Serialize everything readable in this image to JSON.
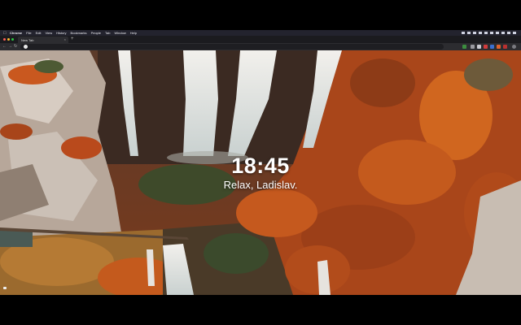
{
  "menubar": {
    "apple_icon": "apple-icon",
    "items": [
      "Chrome",
      "File",
      "Edit",
      "View",
      "History",
      "Bookmarks",
      "People",
      "Tab",
      "Window",
      "Help"
    ]
  },
  "tab": {
    "title": "New Tab",
    "close": "×"
  },
  "toolbar": {
    "new_tab": "+",
    "back": "←",
    "forward": "→",
    "reload": "↻"
  },
  "main": {
    "time": "18:45",
    "greeting": "Relax, Ladislav."
  },
  "colors": {
    "accent": "#e0612b",
    "menubar": "#23232e",
    "tabstrip": "#1b1b1f",
    "toolbar": "#2c2c30"
  }
}
